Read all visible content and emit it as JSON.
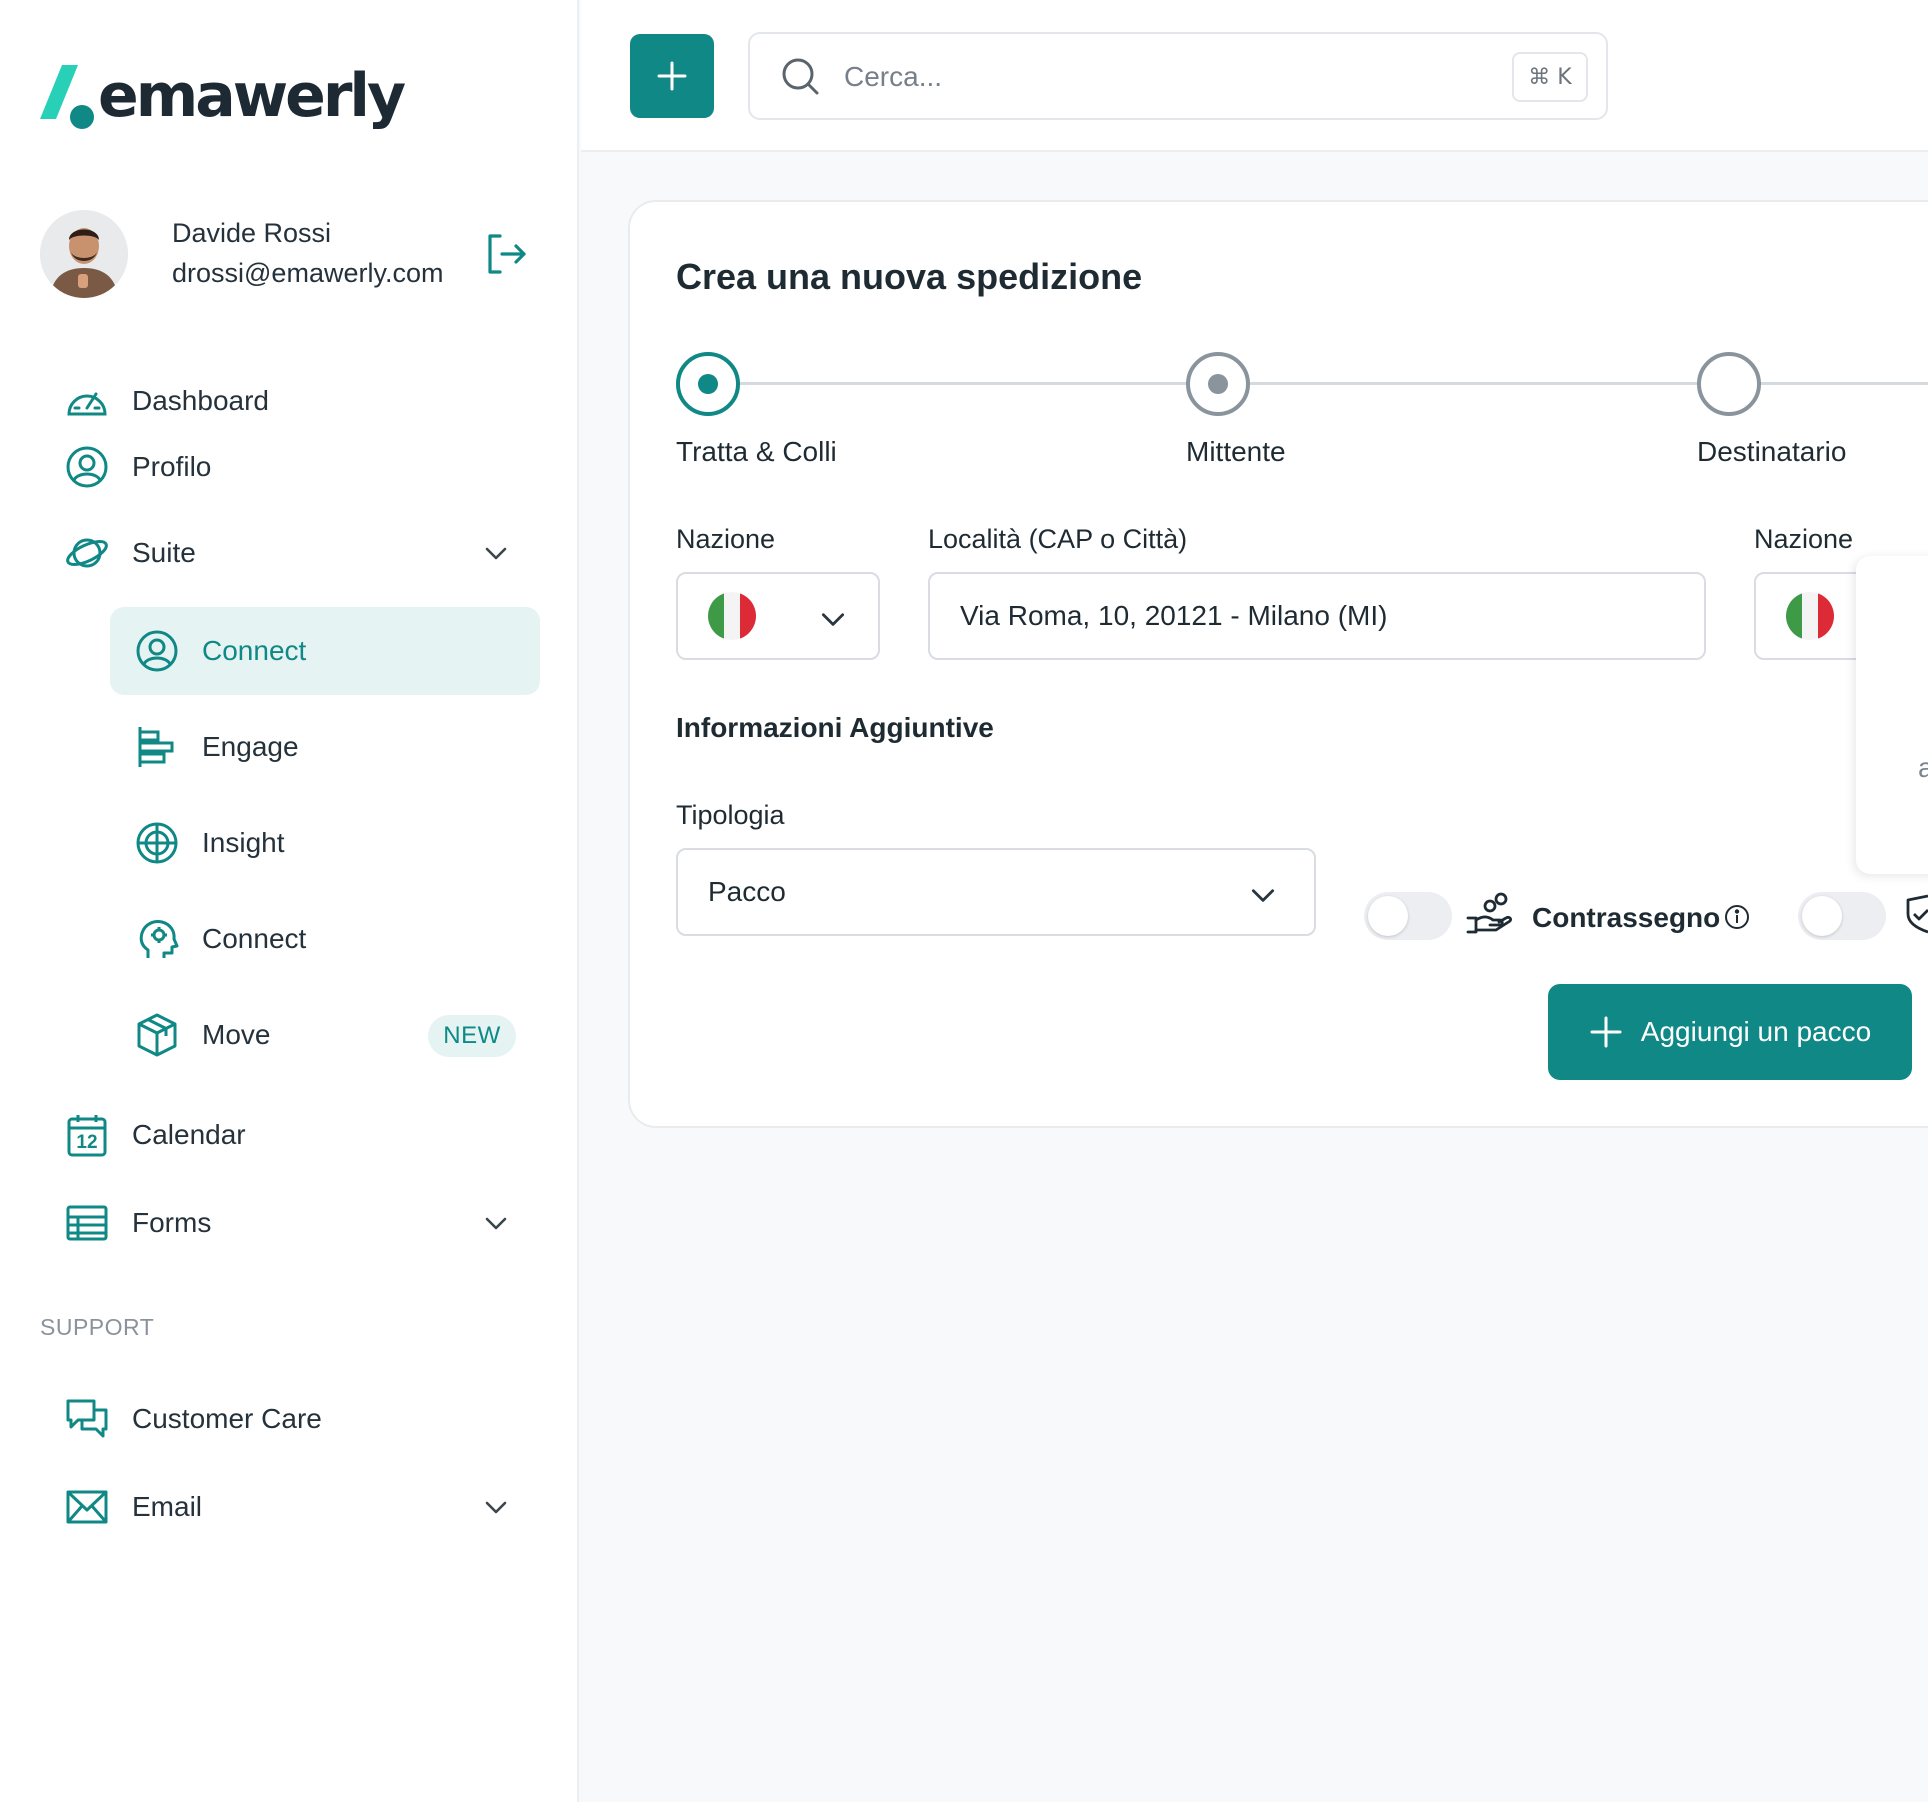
{
  "brand": {
    "name": "emawerly",
    "accent": "#0f8886",
    "teal_light": "#27d0b7",
    "dark": "#1d2a33"
  },
  "user": {
    "name": "Davide Rossi",
    "email": "drossi@emawerly.com"
  },
  "nav": {
    "dashboard": "Dashboard",
    "profile": "Profilo",
    "suite": "Suite",
    "suite_items": [
      {
        "label": "Connect",
        "icon": "user-circle-icon",
        "active": true
      },
      {
        "label": "Engage",
        "icon": "align-bars-icon"
      },
      {
        "label": "Insight",
        "icon": "globe-icon"
      },
      {
        "label": "Connect",
        "icon": "head-gear-icon"
      },
      {
        "label": "Move",
        "icon": "box-icon",
        "badge": "NEW"
      }
    ],
    "calendar": "Calendar",
    "calendar_day": "12",
    "forms": "Forms",
    "support_heading": "SUPPORT",
    "customer_care": "Customer Care",
    "email": "Email"
  },
  "topbar": {
    "search_placeholder": "Cerca...",
    "shortcut": "⌘ K"
  },
  "form": {
    "title": "Crea una nuova spedizione",
    "steps": [
      {
        "label": "Tratta & Colli",
        "state": "active"
      },
      {
        "label": "Mittente",
        "state": "visited"
      },
      {
        "label": "Destinatario",
        "state": "pending"
      }
    ],
    "origin_country_label": "Nazione",
    "origin_location_label": "Località (CAP o Città)",
    "origin_location_value": "Via Roma, 10, 20121 - Milano (MI)",
    "dest_country_label": "Nazione",
    "extra_info_heading": "Informazioni Aggiuntive",
    "type_label": "Tipologia",
    "type_value": "Pacco",
    "cod_label": "Contrassegno",
    "popover_fragment": "a",
    "add_package_label": "Aggiungi un pacco"
  }
}
